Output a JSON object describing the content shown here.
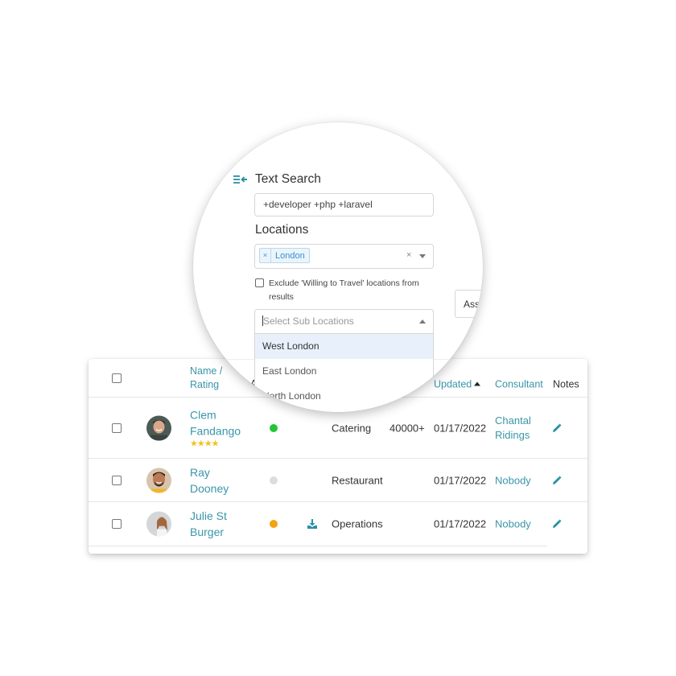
{
  "search_panel": {
    "collapse_icon": "collapse-left-icon",
    "text_search_label": "Text Search",
    "text_search_value": "+developer +php +laravel",
    "locations_label": "Locations",
    "location_tags": [
      "London"
    ],
    "tag_remove_glyph": "×",
    "clear_glyph": "×",
    "exclude_label": "Exclude 'Willing to Travel' locations from results",
    "exclude_checked": false,
    "assign_button_label": "Ass",
    "sub_locations_placeholder": "Select Sub Locations",
    "sub_location_options": [
      "West London",
      "East London",
      "North London"
    ],
    "highlighted_option": "West London"
  },
  "table": {
    "headers": {
      "name": "Name /",
      "rating": "Rating",
      "availability": "A",
      "updated": "Updated",
      "consultant": "Consultant",
      "notes": "Notes"
    },
    "sort": {
      "column": "updated",
      "direction": "asc"
    },
    "rows": [
      {
        "first": "Clem",
        "last": "Fandango",
        "rating": 4,
        "stars": "★★★★",
        "status": "green",
        "status_color": "#22c532",
        "has_cv": false,
        "sector": "Catering",
        "salary": "40000+",
        "updated": "01/17/2022",
        "consultant": "Chantal Ridings",
        "consultant_line1": "Chantal",
        "consultant_line2": "Ridings"
      },
      {
        "first": "Ray",
        "last": "Dooney",
        "rating": 0,
        "stars": "",
        "status": "grey",
        "status_color": "#dddddd",
        "has_cv": false,
        "sector": "Restaurant",
        "salary": "",
        "updated": "01/17/2022",
        "consultant": "Nobody"
      },
      {
        "first": "Julie St",
        "last": "Burger",
        "rating": 0,
        "stars": "",
        "status": "orange",
        "status_color": "#f5a20f",
        "has_cv": true,
        "sector": "Operations",
        "salary": "",
        "updated": "01/17/2022",
        "consultant": "Nobody"
      }
    ]
  },
  "colors": {
    "link": "#3a96a9",
    "accent": "#2a8fa6",
    "star": "#f2c21a",
    "highlight": "#e8f1fb",
    "tag_bg": "#eaf4fb",
    "tag_text": "#3a8fd0"
  }
}
